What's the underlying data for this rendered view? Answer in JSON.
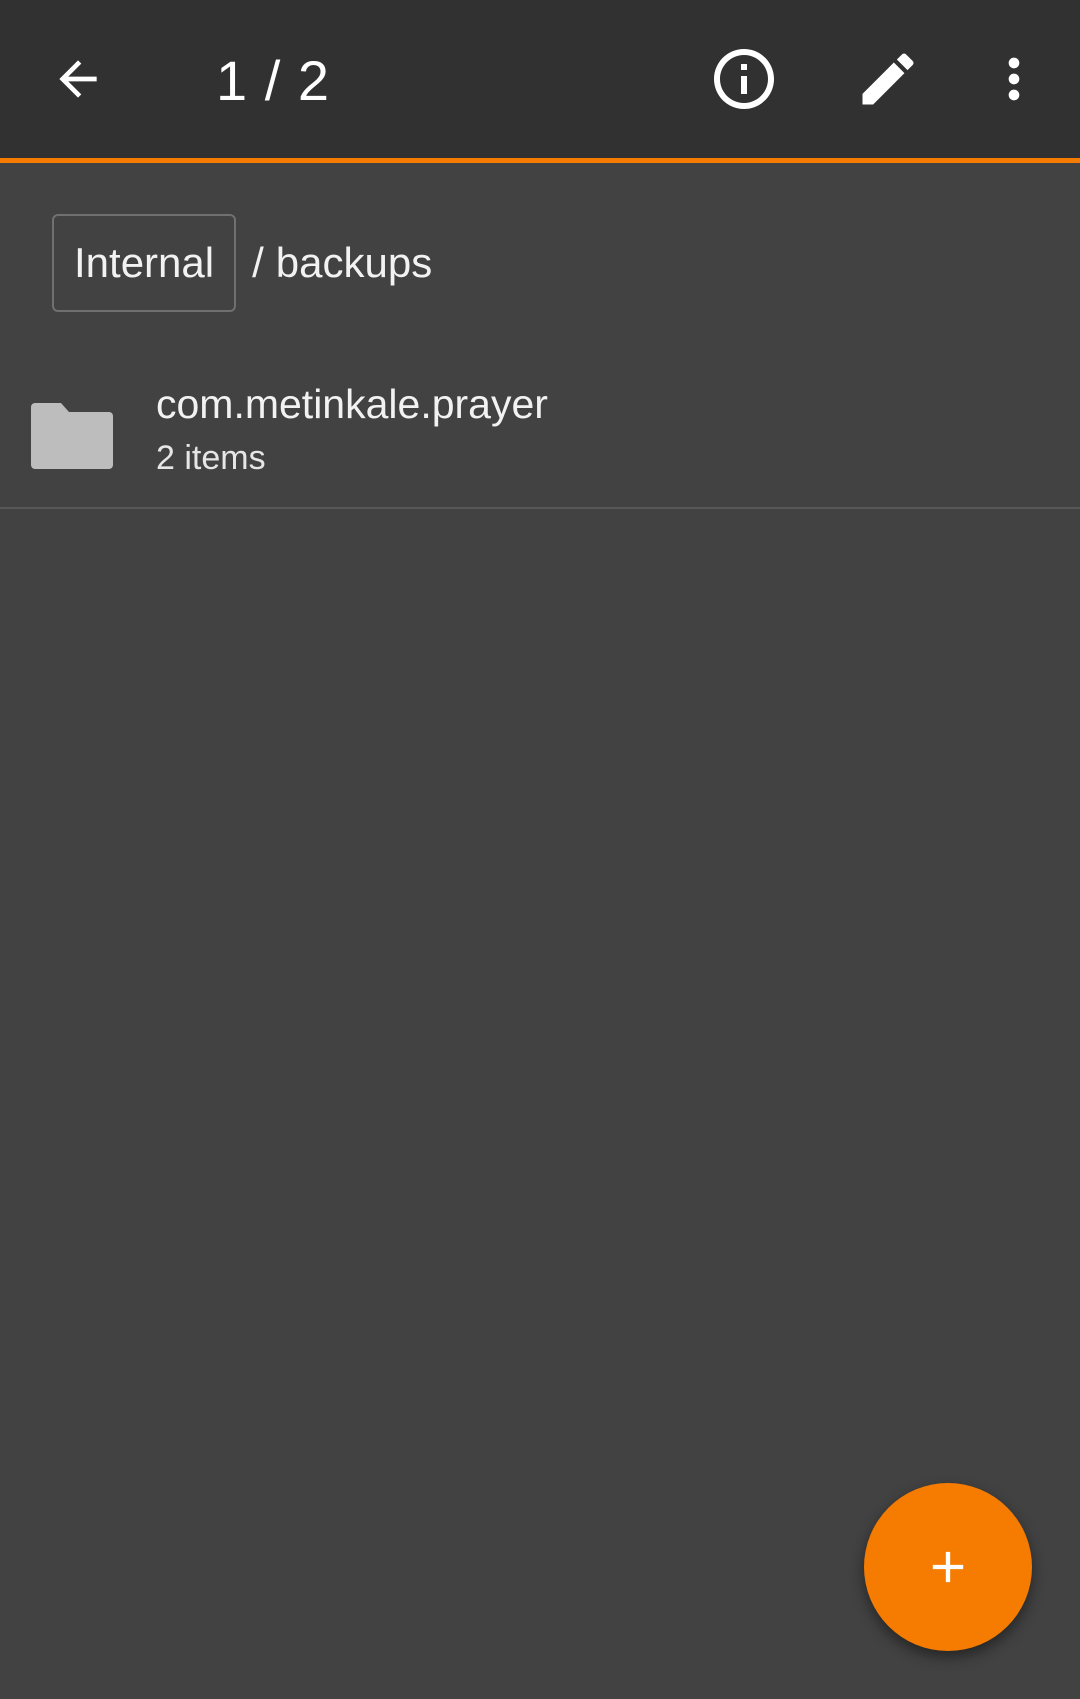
{
  "toolbar": {
    "back_icon": "arrow-left-icon",
    "title": "1 / 2",
    "info_icon": "info-icon",
    "edit_icon": "pencil-icon",
    "overflow_icon": "more-vert-icon"
  },
  "breadcrumb": {
    "root": "Internal",
    "separator": "/",
    "current": "backups"
  },
  "files": [
    {
      "icon": "folder-icon",
      "name": "com.metinkale.prayer",
      "meta": "2 items"
    }
  ],
  "fab": {
    "icon": "plus-icon"
  },
  "colors": {
    "accent": "#F57C00",
    "toolbar": "#313131",
    "background": "#424242",
    "folder": "#BDBDBD"
  }
}
